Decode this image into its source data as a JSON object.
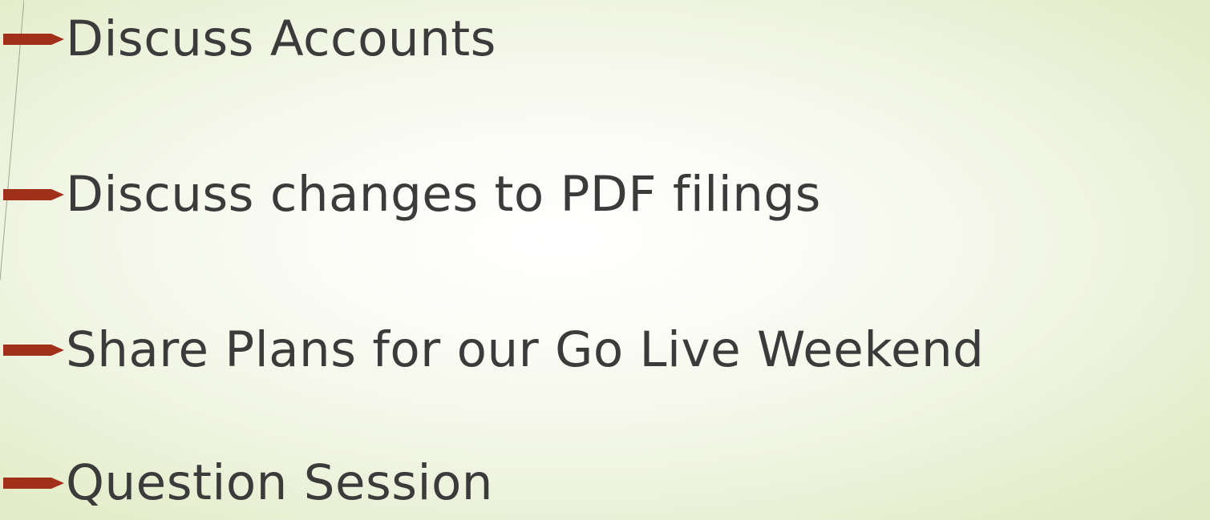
{
  "slide": {
    "bullet_color": "#a1301a",
    "text_color": "#3b3b3b",
    "bullet_icon": "arrow-bullet-icon",
    "bullets": [
      "Discuss Accounts",
      "Discuss changes to PDF filings",
      "Share Plans for our Go Live Weekend",
      "Question Session"
    ]
  }
}
